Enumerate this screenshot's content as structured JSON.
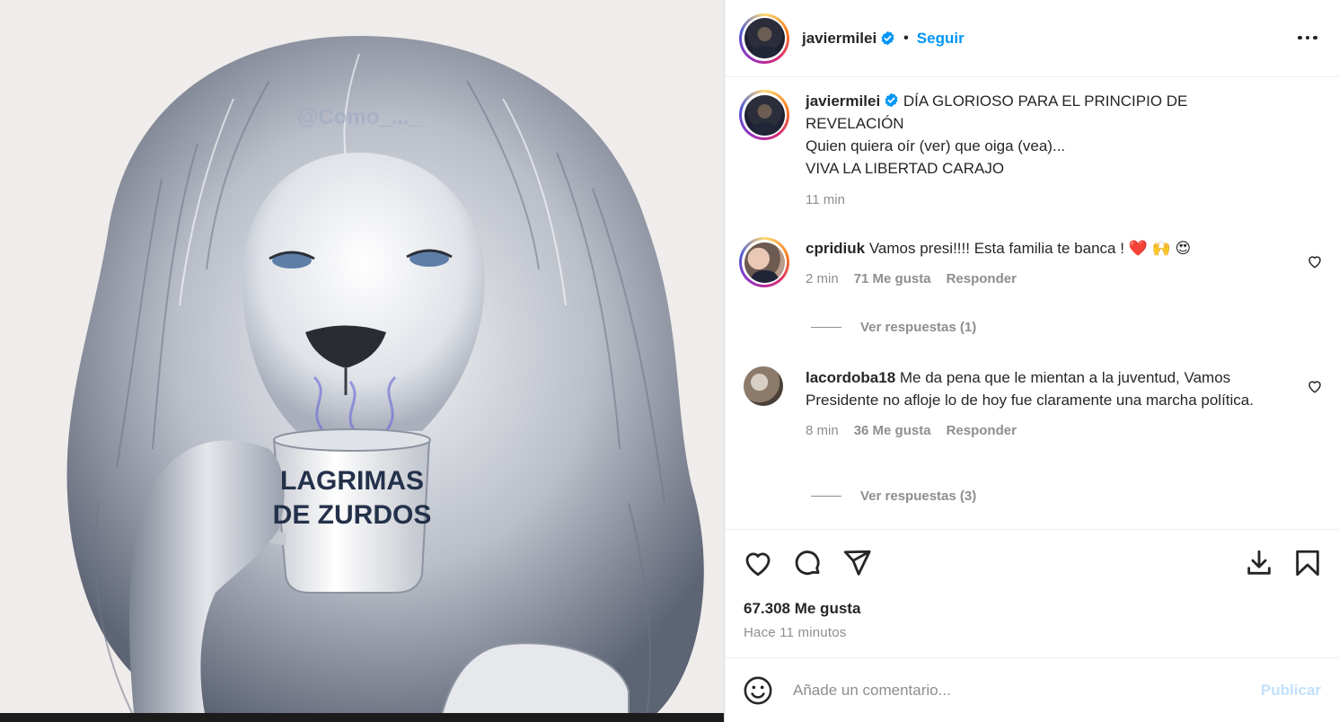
{
  "post": {
    "mug_text_line1": "LAGRIMAS",
    "mug_text_line2": "DE ZURDOS",
    "watermark": "@Como_..._"
  },
  "header": {
    "username": "javiermilei",
    "separator": "•",
    "follow_label": "Seguir"
  },
  "caption": {
    "username": "javiermilei",
    "line1": "DÍA GLORIOSO PARA EL PRINCIPIO DE",
    "line2": "REVELACIÓN",
    "line3": "Quien quiera oír (ver) que oiga (vea)...",
    "line4": "VIVA LA LIBERTAD CARAJO",
    "time": "11 min"
  },
  "comments": [
    {
      "username": "cpridiuk",
      "text": "Vamos presi!!!! Esta familia te banca ! ",
      "emojis": "❤️ 🙌 😍",
      "time": "2 min",
      "likes": "71 Me gusta",
      "reply_label": "Responder",
      "view_replies": "Ver respuestas (1)"
    },
    {
      "username": "lacordoba18",
      "text": "Me da pena que le mientan a la juventud, Vamos Presidente no afloje lo de hoy fue claramente una marcha política.",
      "time": "8 min",
      "likes": "36 Me gusta",
      "reply_label": "Responder",
      "view_replies": "Ver respuestas (3)"
    }
  ],
  "actions": {
    "likes_count": "67.308 Me gusta",
    "time_ago": "Hace 11 minutos",
    "icons": [
      "heart-icon",
      "comment-icon",
      "share-icon",
      "download-icon",
      "bookmark-icon"
    ]
  },
  "add_comment": {
    "placeholder": "Añade un comentario...",
    "publish_label": "Publicar"
  },
  "colors": {
    "accent": "#0095f6",
    "verified": "#0095f6",
    "muted": "#8e8e8e",
    "publish_disabled": "#c3e1fc"
  }
}
